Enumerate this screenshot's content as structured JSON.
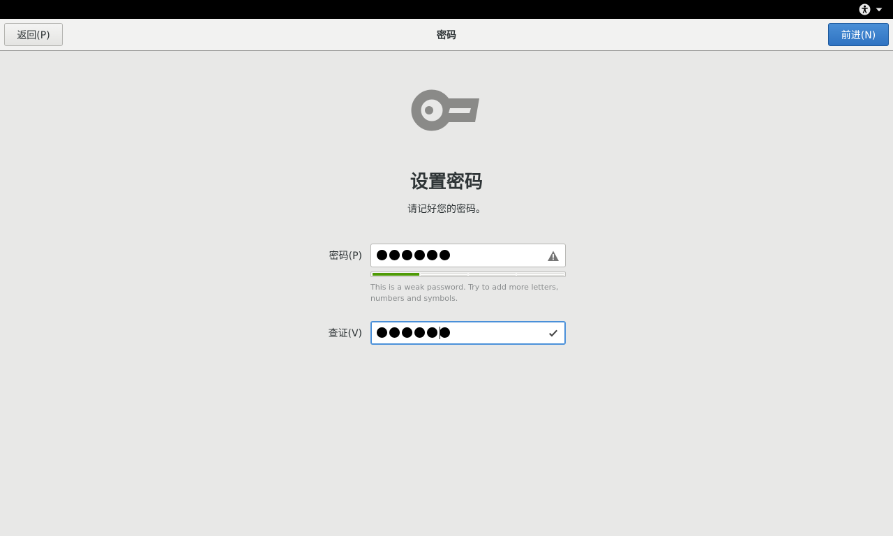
{
  "header": {
    "back_label": "返回(P)",
    "title": "密码",
    "next_label": "前进(N)"
  },
  "topbar": {
    "icons": [
      "accessibility-icon",
      "chevron-down-icon"
    ]
  },
  "page": {
    "icon": "key-icon",
    "heading": "设置密码",
    "subtitle": "请记好您的密码。"
  },
  "password": {
    "label": "密码(P)",
    "masked_count": 6,
    "status_icon": "warning-icon",
    "strength_level": 0.25,
    "hint": "This is a weak password. Try to add more letters, numbers and symbols."
  },
  "verify": {
    "label": "查证(V)",
    "masked_count": 6,
    "status_icon": "checkmark-icon"
  },
  "colors": {
    "accent": "#2f73c2",
    "strength": "#4e9a06"
  }
}
